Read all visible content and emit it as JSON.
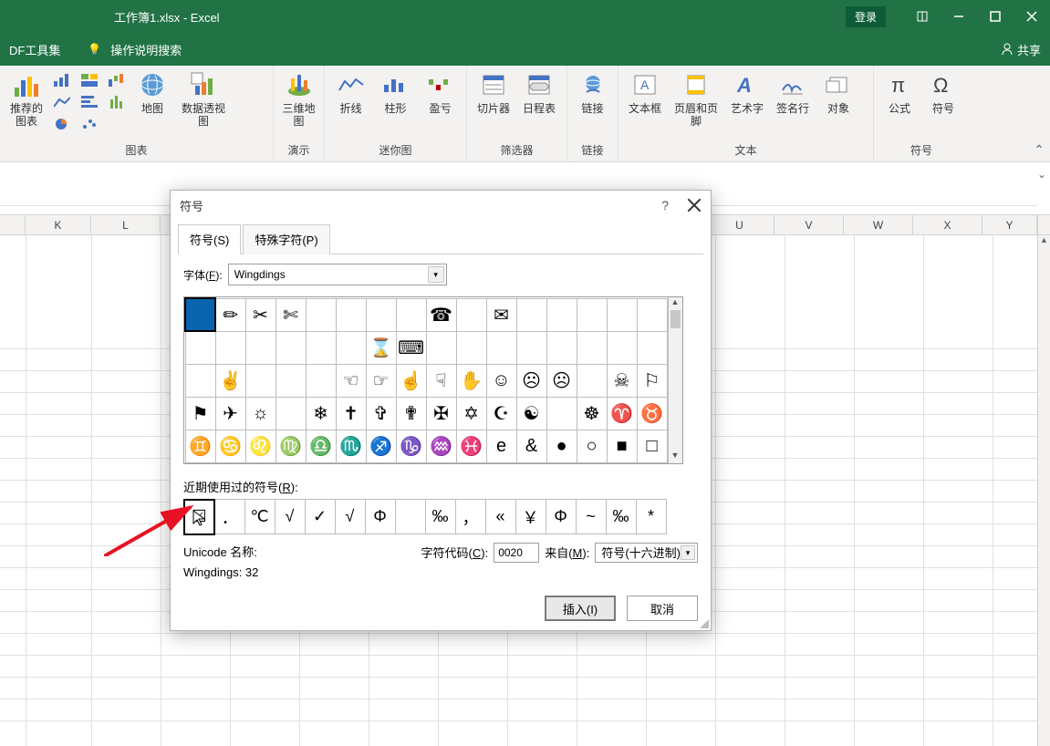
{
  "titlebar": {
    "title": "工作簿1.xlsx  -  Excel",
    "login": "登录"
  },
  "secbar": {
    "tab1": "DF工具集",
    "search": "操作说明搜索",
    "share": "共享"
  },
  "ribbon": {
    "group_charts": "图表",
    "btn_recommended": "推荐的图表",
    "btn_map": "地图",
    "btn_pivot": "数据透视图",
    "group_demo": "演示",
    "btn_3dmap": "三维地图",
    "group_spark": "迷你图",
    "btn_line": "折线",
    "btn_column": "柱形",
    "btn_winloss": "盈亏",
    "group_filter": "筛选器",
    "btn_slicer": "切片器",
    "btn_timeline": "日程表",
    "group_link": "链接",
    "btn_link": "链接",
    "group_text": "文本",
    "btn_textbox": "文本框",
    "btn_header": "页眉和页脚",
    "btn_wordart": "艺术字",
    "btn_sigline": "签名行",
    "btn_object": "对象",
    "group_symbol": "符号",
    "btn_equation": "公式",
    "btn_symbol": "符号"
  },
  "cols": [
    "K",
    "L",
    "U",
    "V",
    "W",
    "X",
    "Y"
  ],
  "dialog": {
    "title": "符号",
    "tab_symbol": "符号(S)",
    "tab_special": "特殊字符(P)",
    "font_label": "字体(F):",
    "font_value": "Wingdings",
    "grid": [
      [
        "",
        "✏",
        "✂",
        "✄",
        "",
        "",
        "",
        "",
        "☎",
        "",
        "✉",
        "",
        "",
        "",
        "",
        ""
      ],
      [
        "",
        "",
        "",
        "",
        "",
        "",
        "⌛",
        "⌨",
        "",
        "",
        "",
        "",
        "",
        "",
        "",
        ""
      ],
      [
        "",
        "✌",
        "",
        "",
        "",
        "☜",
        "☞",
        "☝",
        "☟",
        "✋",
        "☺",
        "☹",
        "☹",
        "",
        "☠",
        "⚐"
      ],
      [
        "⚑",
        "✈",
        "☼",
        "",
        "❄",
        "✝",
        "✞",
        "✟",
        "✠",
        "✡",
        "☪",
        "☯",
        "",
        "☸",
        "♈",
        "♉"
      ],
      [
        "♊",
        "♋",
        "♌",
        "♍",
        "♎",
        "♏",
        "♐",
        "♑",
        "♒",
        "♓",
        "e",
        "&",
        "●",
        "○",
        "■",
        "□"
      ]
    ],
    "recent_label": "近期使用过的符号(R):",
    "recent": [
      "☑",
      "．",
      "℃",
      "√",
      "✓",
      "√",
      "Φ",
      "",
      "‰",
      "，",
      "«",
      "￥",
      "Φ",
      "~",
      "‰",
      "*"
    ],
    "unicode_name_label": "Unicode 名称:",
    "wingdings_label": "Wingdings: 32",
    "charcode_label": "字符代码(C):",
    "charcode_value": "0020",
    "from_label": "来自(M):",
    "from_value": "符号(十六进制)",
    "btn_insert": "插入(I)",
    "btn_cancel": "取消"
  }
}
